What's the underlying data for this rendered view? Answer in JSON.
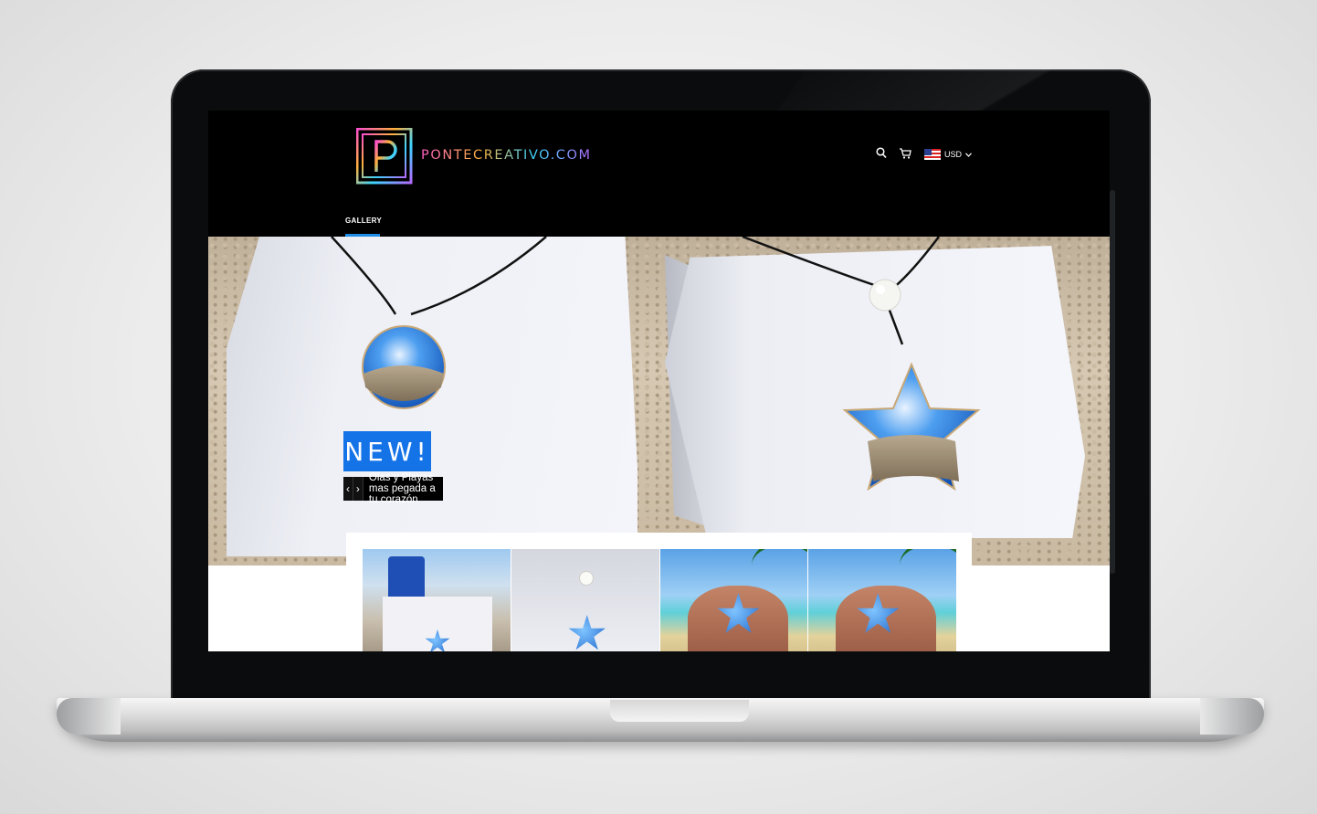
{
  "site": {
    "logo_text": "PONTECREATIVO.COM",
    "nav_items": [
      {
        "label": "GALLERY"
      }
    ],
    "currency": "USD",
    "icons": [
      "search-icon",
      "cart-icon",
      "us-flag-icon",
      "chevron-down-icon"
    ]
  },
  "hero": {
    "badge": "NEW!",
    "caption": "Olas y Playas mas pegada a tu corazón",
    "prev_arrow": "‹",
    "next_arrow": "›"
  },
  "colors": {
    "accent": "#1573e8",
    "header_bg": "#000000",
    "underline": "#1f8ce6"
  }
}
